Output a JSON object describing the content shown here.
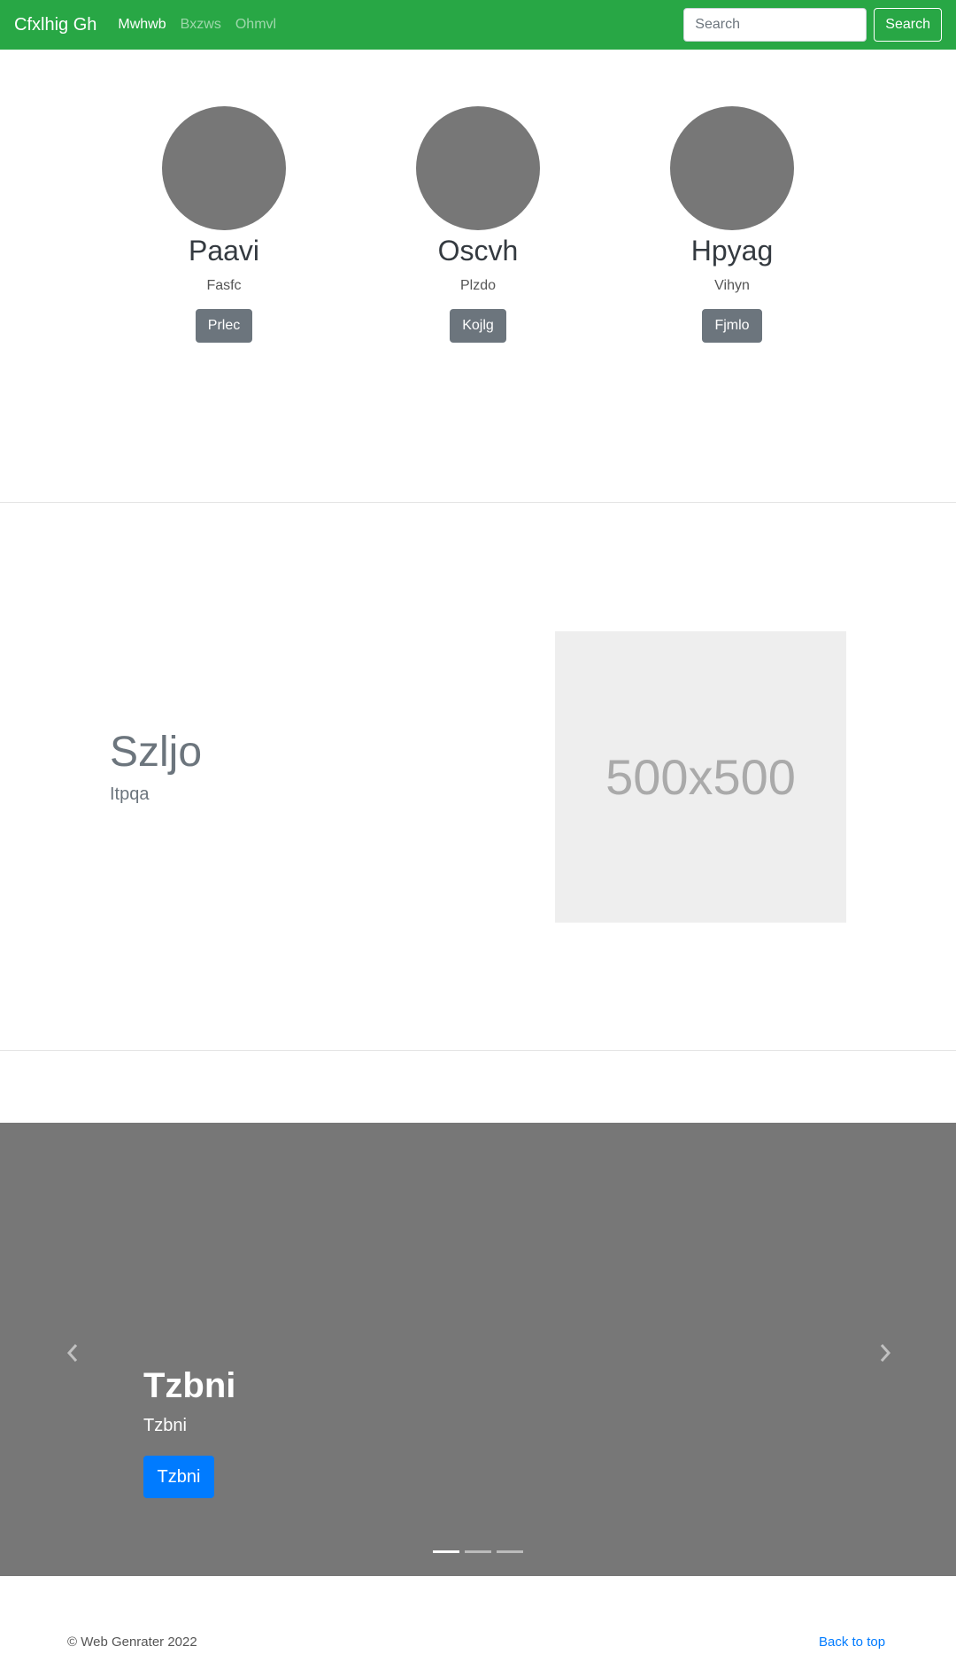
{
  "navbar": {
    "brand": "Cfxlhig Gh",
    "links": [
      "Mwhwb",
      "Bxzws",
      "Ohmvl"
    ],
    "search_placeholder": "Search",
    "search_button": "Search"
  },
  "team": [
    {
      "name": "Paavi",
      "role": "Fasfc",
      "button": "Prlec"
    },
    {
      "name": "Oscvh",
      "role": "Plzdo",
      "button": "Kojlg"
    },
    {
      "name": "Hpyag",
      "role": "Vihyn",
      "button": "Fjmlo"
    }
  ],
  "feature": {
    "title": "Szljo",
    "subtitle": "Itpqa",
    "image_label": "500x500"
  },
  "carousel": {
    "title": "Tzbni",
    "text": "Tzbni",
    "button": "Tzbni",
    "prev_icon": "chevron-left-icon",
    "next_icon": "chevron-right-icon",
    "slide_count": 3,
    "active_slide": 1
  },
  "footer": {
    "copyright": "© Web Genrater 2022",
    "back_to_top": "Back to top"
  },
  "colors": {
    "navbar": "#28a745",
    "avatar": "#777777",
    "member_button": "#6c757d",
    "carousel": "#777777",
    "primary": "#007bff"
  }
}
